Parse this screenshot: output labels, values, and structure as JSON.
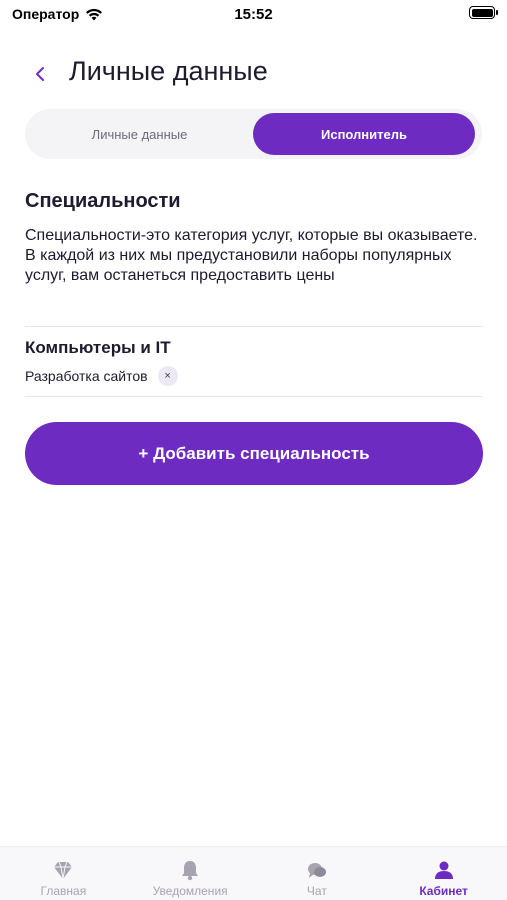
{
  "status_bar": {
    "carrier": "Оператор",
    "time": "15:52"
  },
  "header": {
    "title": "Личные данные",
    "back_icon": "chevron-left-icon"
  },
  "segmented": {
    "options": [
      {
        "label": "Личные данные",
        "selected": false
      },
      {
        "label": "Исполнитель",
        "selected": true
      }
    ]
  },
  "section": {
    "title": "Специальности",
    "description": "Специальности-это категория услуг, которые вы оказываете. В каждой из них мы предустановили наборы популярных услуг, вам останеться предоставить цены"
  },
  "category": {
    "title": "Компьютеры и IT",
    "tags": [
      {
        "label": "Разработка сайтов",
        "remove_label": "×"
      }
    ]
  },
  "add_button": {
    "label": "+ Добавить специальность"
  },
  "tabbar": {
    "items": [
      {
        "label": "Главная",
        "icon": "diamond-icon",
        "active": false
      },
      {
        "label": "Уведомления",
        "icon": "bell-icon",
        "active": false
      },
      {
        "label": "Чат",
        "icon": "chat-icon",
        "active": false
      },
      {
        "label": "Кабинет",
        "icon": "user-icon",
        "active": true
      }
    ]
  },
  "colors": {
    "accent": "#6e2bc2",
    "inactive_tab": "#a7a3b0",
    "segment_bg": "#f4f3f6",
    "text": "#1d1b2e"
  }
}
